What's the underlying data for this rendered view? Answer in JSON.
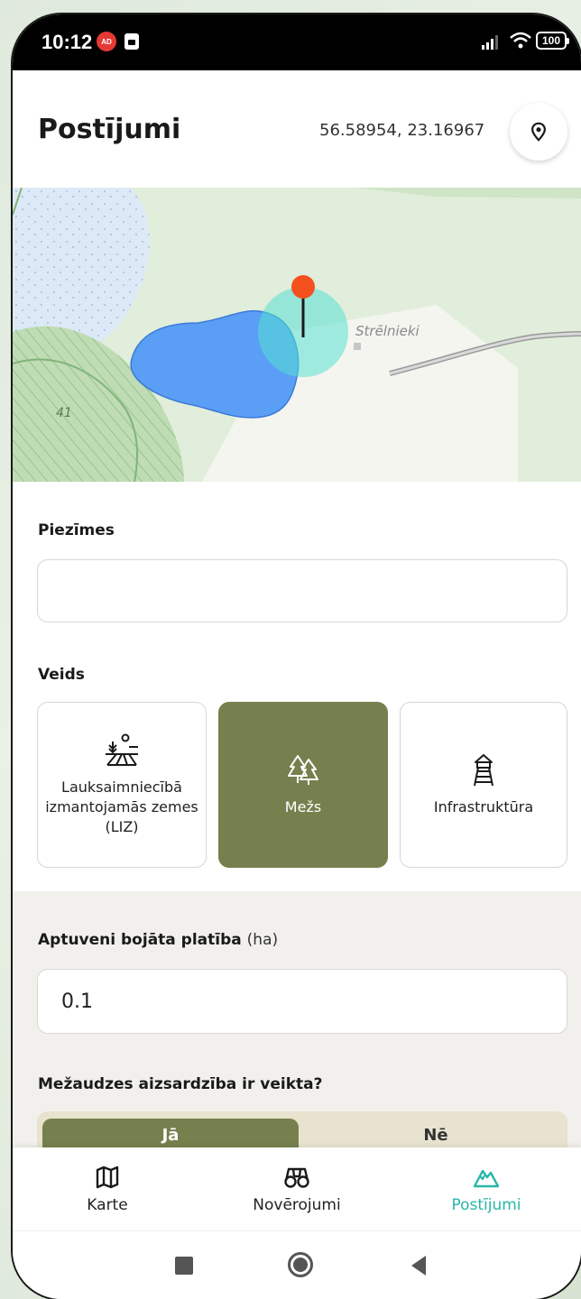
{
  "status_bar": {
    "time": "10:12",
    "ad_badge": "AD",
    "battery": "100"
  },
  "header": {
    "title": "Postījumi",
    "coordinates": "56.58954, 23.16967"
  },
  "map": {
    "place_label": "Strēlnieki",
    "parcel_label": "41"
  },
  "notes": {
    "label": "Piezīmes",
    "value": "",
    "placeholder": ""
  },
  "type_section": {
    "label": "Veids",
    "options": [
      {
        "label": "Lauksaimniecībā izmantojamās zemes (LIZ)",
        "icon": "farmland-icon",
        "selected": false
      },
      {
        "label": "Mežs",
        "icon": "forest-icon",
        "selected": true
      },
      {
        "label": "Infrastruktūra",
        "icon": "tower-icon",
        "selected": false
      }
    ]
  },
  "damaged_area": {
    "label": "Aptuveni bojāta platība",
    "unit": "(ha)",
    "value": "0.1"
  },
  "protection": {
    "label": "Mežaudzes aizsardzība ir veikta?",
    "yes_label": "Jā",
    "no_label": "Nē",
    "selected": "yes"
  },
  "bottom_nav": {
    "items": [
      {
        "label": "Karte",
        "icon": "map-icon",
        "active": false
      },
      {
        "label": "Novērojumi",
        "icon": "binoculars-icon",
        "active": false
      },
      {
        "label": "Postījumi",
        "icon": "mountain-icon",
        "active": true
      }
    ]
  },
  "colors": {
    "accent_olive": "#76804e",
    "active_teal": "#29b6a8",
    "marker_orange": "#f4511e",
    "area_blue": "#5a9ef5"
  }
}
